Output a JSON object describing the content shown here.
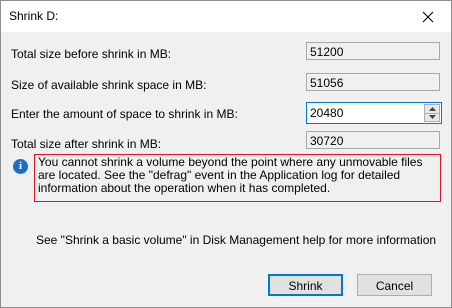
{
  "window": {
    "title": "Shrink D:",
    "close_icon": "close-icon"
  },
  "fields": {
    "total_size_label": "Total size before shrink in MB:",
    "total_size_value": "51200",
    "available_label": "Size of available shrink space in MB:",
    "available_value": "51056",
    "amount_label": "Enter the amount of space to shrink in MB:",
    "amount_value": "20480",
    "after_label": "Total size after shrink in MB:",
    "after_value": "30720"
  },
  "warning": {
    "icon": "info-icon",
    "text": "You cannot shrink a volume beyond the point where any unmovable files are located. See the \"defrag\" event in the Application log for detailed information about the operation when it has completed."
  },
  "help": {
    "text": "See \"Shrink a basic volume\" in Disk Management help for more information"
  },
  "buttons": {
    "shrink": "Shrink",
    "cancel": "Cancel"
  },
  "colors": {
    "accent": "#0078d7",
    "warning_border": "#e81123",
    "info_icon": "#1d6ec5",
    "dialog_bg": "#f0f0f0"
  }
}
